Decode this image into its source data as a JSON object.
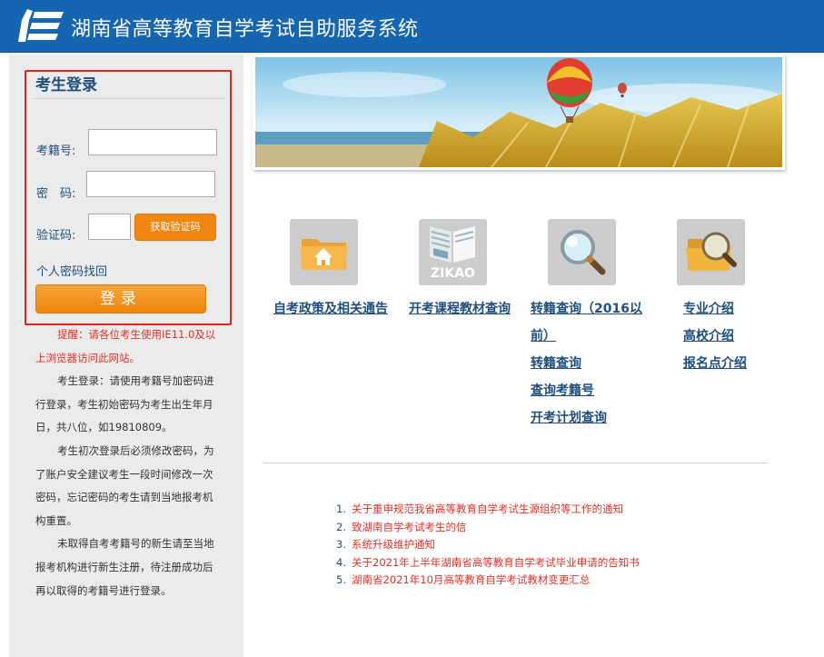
{
  "header": {
    "title": "湖南省高等教育自学考试自助服务系统"
  },
  "login": {
    "title": "考生登录",
    "exam_id_label": "考籍号:",
    "password_label": "密　码:",
    "captcha_label": "验证码:",
    "get_code_button": "获取验证码",
    "forgot_link": "个人密码找回",
    "login_button": "登录"
  },
  "tips": {
    "warning": "提醒：请各位考生使用IE11.0及以上浏览器访问此网站。",
    "paragraphs": [
      "考生登录：请使用考籍号加密码进行登录，考生初始密码为考生出生年月日，共八位，如19810809。",
      "考生初次登录后必须修改密码，为了账户安全建议考生一段时间修改一次密码，忘记密码的考生请到当地报考机构重置。",
      "未取得自考考籍号的新生请至当地报考机构进行新生注册，待注册成功后再以取得的考籍号进行登录。"
    ]
  },
  "quick_links": {
    "col1": [
      "自考政策及相关通告"
    ],
    "col2": [
      "开考课程教材查询"
    ],
    "col3": [
      "转籍查询（2016以",
      "前）",
      "转籍查询",
      "查询考籍号",
      "开考计划查询"
    ],
    "col4": [
      "专业介绍",
      "高校介绍",
      "报名点介绍"
    ],
    "zikao_icon_text": "ZIKAO"
  },
  "news": [
    {
      "num": "1.",
      "title": "关于重申规范我省高等教育自学考试生源组织等工作的通知"
    },
    {
      "num": "2.",
      "title": "致湖南自学考试考生的信"
    },
    {
      "num": "3.",
      "title": "系统升级维护通知"
    },
    {
      "num": "4.",
      "title": "关于2021年上半年湖南省高等教育自学考试毕业申请的告知书"
    },
    {
      "num": "5.",
      "title": "湖南省2021年10月高等教育自学考试教材变更汇总"
    }
  ],
  "colors": {
    "header_blue": "#1565b0",
    "link_blue": "#1f4f7d",
    "accent_orange": "#f0860f",
    "alert_red": "#e03027",
    "highlight_border": "#e8211a"
  }
}
